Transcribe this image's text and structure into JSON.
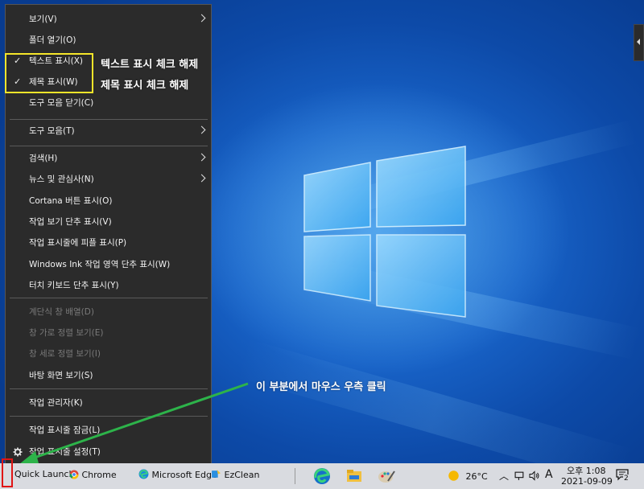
{
  "context_menu": {
    "items": [
      {
        "label": "보기(V)",
        "submenu": true,
        "checked": false,
        "disabled": false
      },
      {
        "label": "폴더 열기(O)",
        "submenu": false,
        "checked": false,
        "disabled": false
      },
      {
        "label": "텍스트 표시(X)",
        "submenu": false,
        "checked": true,
        "disabled": false
      },
      {
        "label": "제목 표시(W)",
        "submenu": false,
        "checked": true,
        "disabled": false
      },
      {
        "label": "도구 모음 닫기(C)",
        "submenu": false,
        "checked": false,
        "disabled": false
      },
      {
        "label": "도구 모음(T)",
        "submenu": true,
        "checked": false,
        "disabled": false
      },
      {
        "label": "검색(H)",
        "submenu": true,
        "checked": false,
        "disabled": false
      },
      {
        "label": "뉴스 및 관심사(N)",
        "submenu": true,
        "checked": false,
        "disabled": false
      },
      {
        "label": "Cortana 버튼 표시(O)",
        "submenu": false,
        "checked": false,
        "disabled": false
      },
      {
        "label": "작업 보기 단추 표시(V)",
        "submenu": false,
        "checked": false,
        "disabled": false
      },
      {
        "label": "작업 표시줄에 피플 표시(P)",
        "submenu": false,
        "checked": false,
        "disabled": false
      },
      {
        "label": "Windows Ink 작업 영역 단추 표시(W)",
        "submenu": false,
        "checked": false,
        "disabled": false
      },
      {
        "label": "터치 키보드 단추 표시(Y)",
        "submenu": false,
        "checked": false,
        "disabled": false
      },
      {
        "label": "계단식 창 배열(D)",
        "submenu": false,
        "checked": false,
        "disabled": true
      },
      {
        "label": "창 가로 정렬 보기(E)",
        "submenu": false,
        "checked": false,
        "disabled": true
      },
      {
        "label": "창 세로 정렬 보기(I)",
        "submenu": false,
        "checked": false,
        "disabled": true
      },
      {
        "label": "바탕 화면 보기(S)",
        "submenu": false,
        "checked": false,
        "disabled": false
      },
      {
        "label": "작업 관리자(K)",
        "submenu": false,
        "checked": false,
        "disabled": false
      },
      {
        "label": "작업 표시줄 잠금(L)",
        "submenu": false,
        "checked": false,
        "disabled": false
      },
      {
        "label": "작업 표시줄 설정(T)",
        "submenu": false,
        "checked": false,
        "disabled": false,
        "icon": "gear-icon"
      }
    ]
  },
  "annotations": {
    "text_uncheck": "텍스트 표시 체크 해제",
    "title_uncheck": "제목 표시 체크 해제",
    "right_click_hint": "이 부분에서 마우스 우측 클릭"
  },
  "taskbar": {
    "quick_launch": "Quick Launch",
    "apps": [
      {
        "label": "Chrome",
        "icon": "chrome-icon"
      },
      {
        "label": "Microsoft Edge",
        "icon": "edge-icon"
      },
      {
        "label": "EzClean",
        "icon": "ezclean-icon"
      }
    ],
    "pinned": [
      "edge-icon",
      "file-explorer-icon",
      "paint-icon"
    ],
    "tray": {
      "weather": "26°C",
      "ime": "A",
      "time": "오후 1:08",
      "date": "2021-09-09",
      "notification_count": "2"
    }
  },
  "colors": {
    "menu_bg": "#2b2b2b",
    "highlight_box": "#f5e52a",
    "arrow": "#2db34a",
    "red_box": "#e01515"
  }
}
